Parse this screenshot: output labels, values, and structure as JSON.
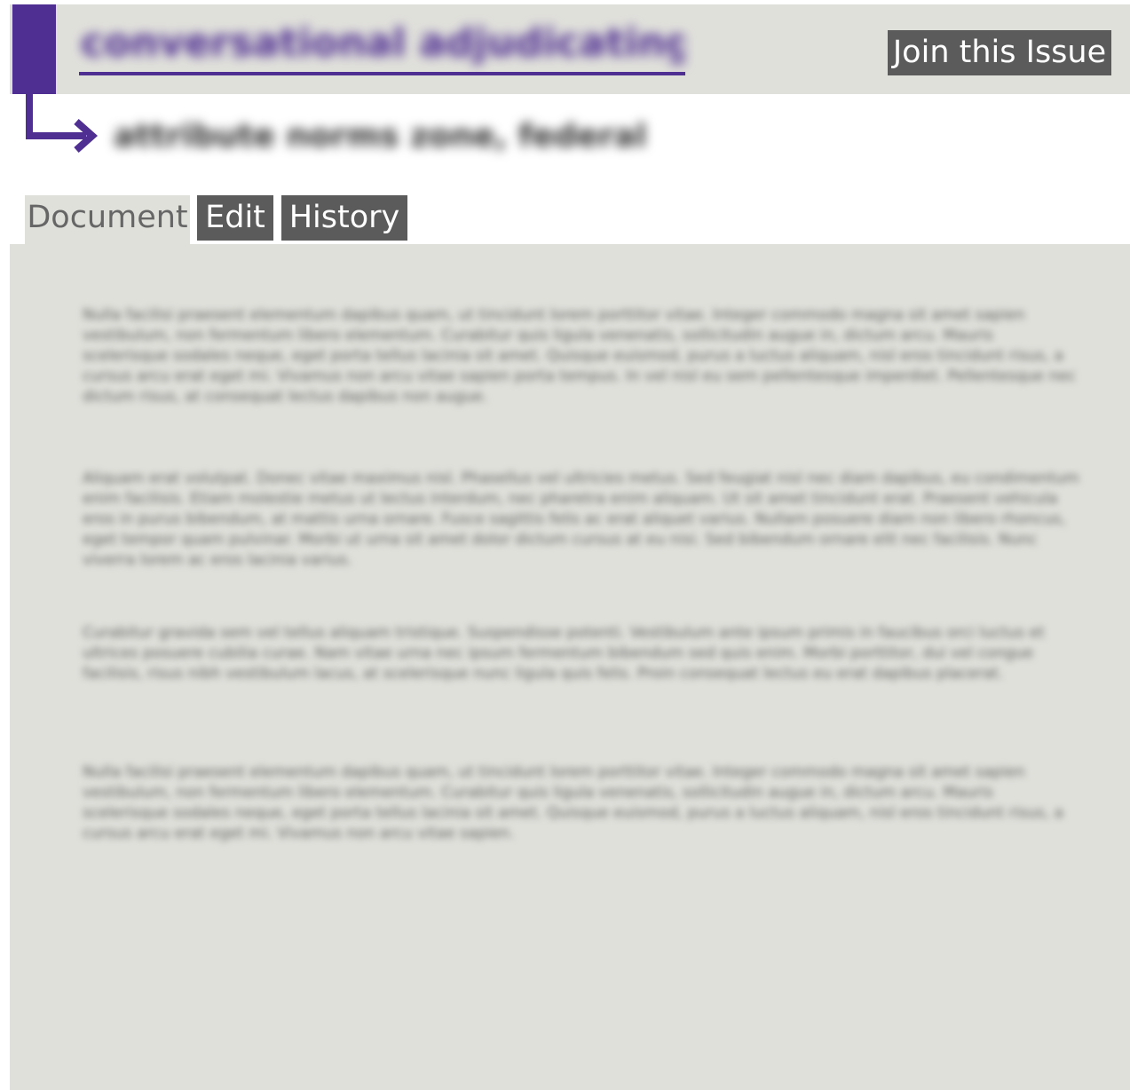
{
  "header": {
    "issue_title": "conversational adjudicating site",
    "join_button_label": "Join this Issue"
  },
  "subheader": {
    "subtitle": "attribute norms zone, federal"
  },
  "tabs": [
    {
      "label": "Document"
    },
    {
      "label": "Edit"
    },
    {
      "label": "History"
    }
  ],
  "document": {
    "paragraphs": [
      "Nulla facilisi praesent elementum dapibus quam, ut tincidunt lorem porttitor vitae. Integer commodo magna sit amet sapien vestibulum, non fermentum libero elementum. Curabitur quis ligula venenatis, sollicitudin augue in, dictum arcu. Mauris scelerisque sodales neque, eget porta tellus lacinia sit amet. Quisque euismod, purus a luctus aliquam, nisl eros tincidunt risus, a cursus arcu erat eget mi. Vivamus non arcu vitae sapien porta tempus. In vel nisl eu sem pellentesque imperdiet. Pellentesque nec dictum risus, at consequat lectus dapibus non augue.",
      "Aliquam erat volutpat. Donec vitae maximus nisl. Phasellus vel ultricies metus. Sed feugiat nisl nec diam dapibus, eu condimentum enim facilisis. Etiam molestie metus ut lectus interdum, nec pharetra enim aliquam. Ut sit amet tincidunt erat. Praesent vehicula eros in purus bibendum, at mattis urna ornare. Fusce sagittis felis ac erat aliquet varius. Nullam posuere diam non libero rhoncus, eget tempor quam pulvinar. Morbi ut urna sit amet dolor dictum cursus at eu nisi. Sed bibendum ornare elit nec facilisis. Nunc viverra lorem ac eros lacinia varius.",
      "Curabitur gravida sem vel tellus aliquam tristique. Suspendisse potenti. Vestibulum ante ipsum primis in faucibus orci luctus et ultrices posuere cubilia curae. Nam vitae urna nec ipsum fermentum bibendum sed quis enim. Morbi porttitor, dui vel congue facilisis, risus nibh vestibulum lacus, at scelerisque nunc ligula quis felis. Proin consequat lectus eu erat dapibus placerat.",
      "Nulla facilisi praesent elementum dapibus quam, ut tincidunt lorem porttitor vitae. Integer commodo magna sit amet sapien vestibulum, non fermentum libero elementum. Curabitur quis ligula venenatis, sollicitudin augue in, dictum arcu. Mauris scelerisque sodales neque, eget porta tellus lacinia sit amet. Quisque euismod, purus a luctus aliquam, nisl eros tincidunt risus, a cursus arcu erat eget mi. Vivamus non arcu vitae sapien."
    ]
  },
  "colors": {
    "accent": "#4f2f91",
    "header_background": "#e0e0db",
    "button_background": "#5b5b5b",
    "panel_background": "#e0e0db"
  },
  "icons": {
    "subtitle_arrow": "arrow-turn-right-icon"
  }
}
